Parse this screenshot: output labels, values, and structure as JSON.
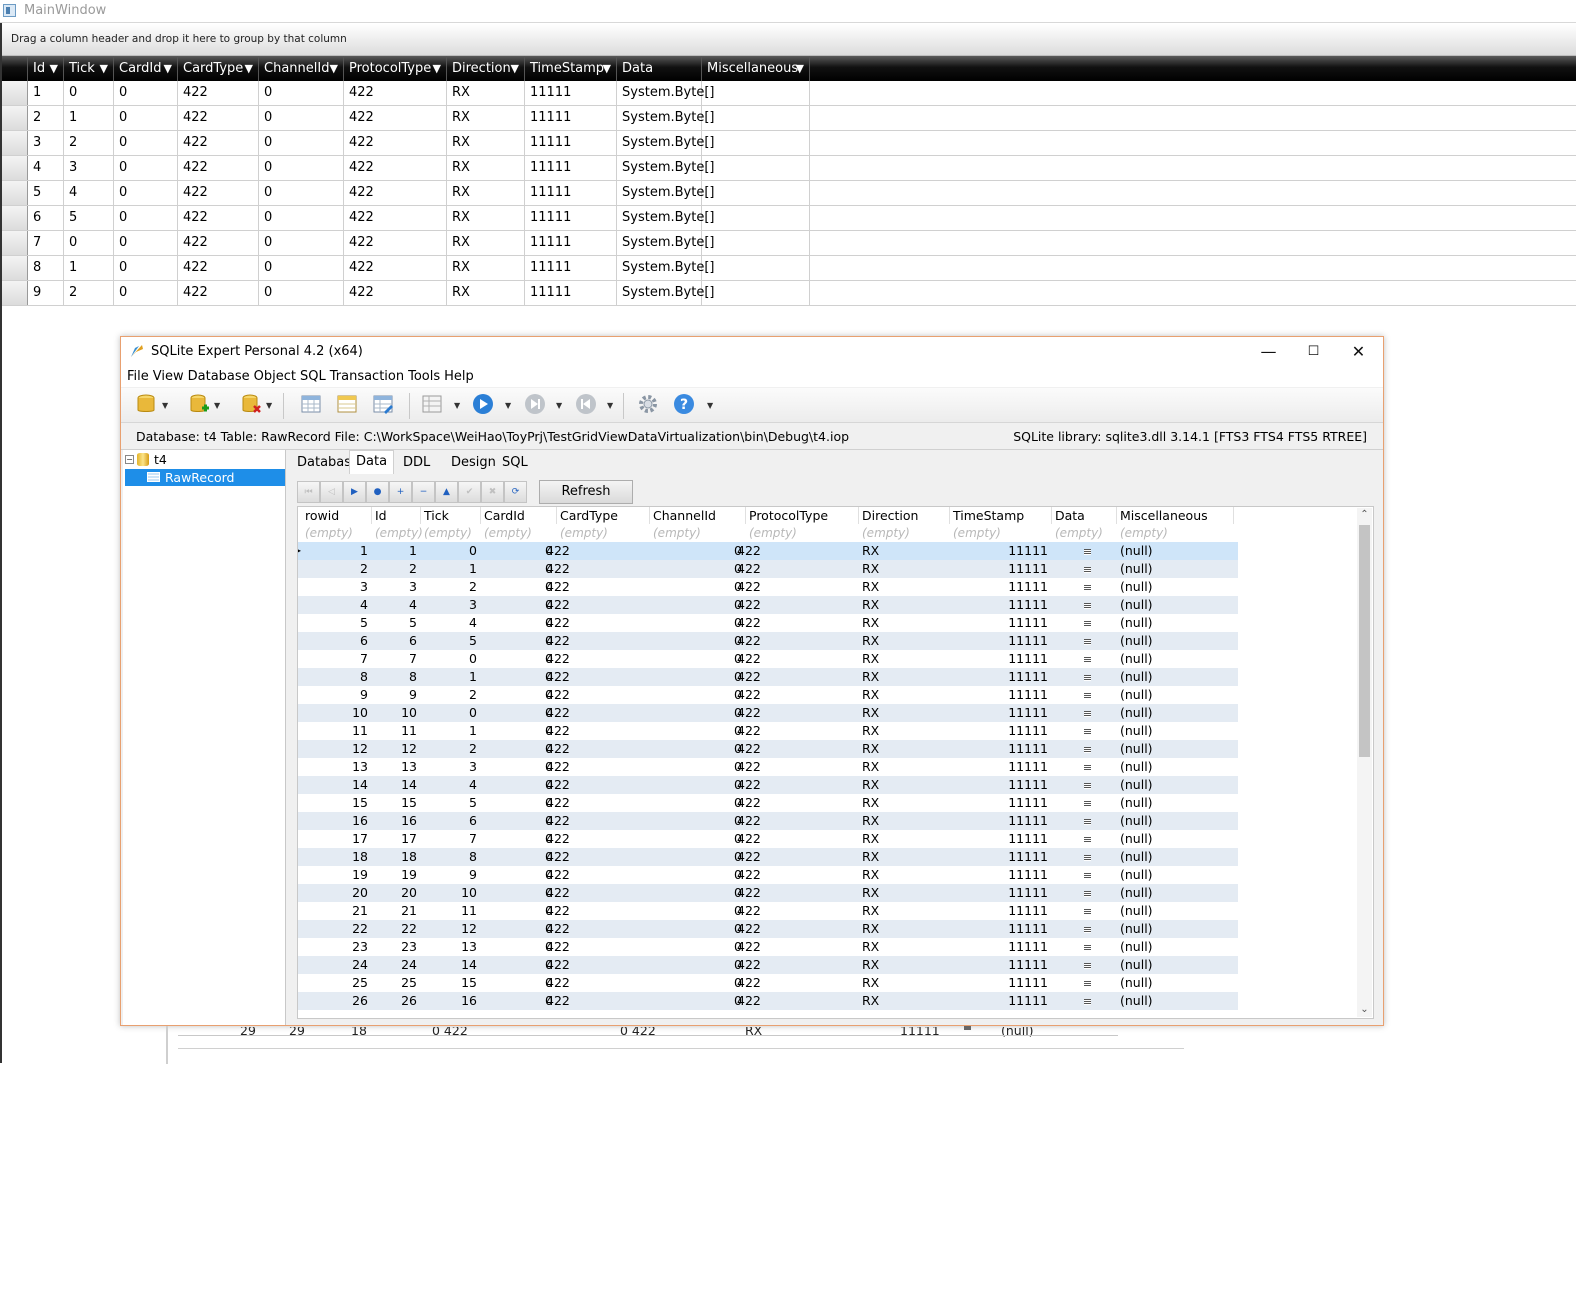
{
  "main_window": {
    "title": "MainWindow",
    "group_panel_hint": "Drag a column header and drop it here to group by that column",
    "columns": [
      "Id",
      "Tick",
      "CardId",
      "CardType",
      "ChannelId",
      "ProtocolType",
      "Direction",
      "TimeStamp",
      "Data",
      "Miscellaneous"
    ],
    "rows": [
      [
        "1",
        "0",
        "0",
        "422",
        "0",
        "422",
        "RX",
        "11111",
        "System.Byte[]",
        ""
      ],
      [
        "2",
        "1",
        "0",
        "422",
        "0",
        "422",
        "RX",
        "11111",
        "System.Byte[]",
        ""
      ],
      [
        "3",
        "2",
        "0",
        "422",
        "0",
        "422",
        "RX",
        "11111",
        "System.Byte[]",
        ""
      ],
      [
        "4",
        "3",
        "0",
        "422",
        "0",
        "422",
        "RX",
        "11111",
        "System.Byte[]",
        ""
      ],
      [
        "5",
        "4",
        "0",
        "422",
        "0",
        "422",
        "RX",
        "11111",
        "System.Byte[]",
        ""
      ],
      [
        "6",
        "5",
        "0",
        "422",
        "0",
        "422",
        "RX",
        "11111",
        "System.Byte[]",
        ""
      ],
      [
        "7",
        "0",
        "0",
        "422",
        "0",
        "422",
        "RX",
        "11111",
        "System.Byte[]",
        ""
      ],
      [
        "8",
        "1",
        "0",
        "422",
        "0",
        "422",
        "RX",
        "11111",
        "System.Byte[]",
        ""
      ],
      [
        "9",
        "2",
        "0",
        "422",
        "0",
        "422",
        "RX",
        "11111",
        "System.Byte[]",
        ""
      ]
    ]
  },
  "sqlite_expert": {
    "title": "SQLite Expert Personal 4.2 (x64)",
    "window_buttons": {
      "minimize": "—",
      "maximize": "☐",
      "close": "✕"
    },
    "menu": [
      "File",
      "View",
      "Database",
      "Object",
      "SQL",
      "Transaction",
      "Tools",
      "Help"
    ],
    "info_left": "Database: t4  Table: RawRecord  File: C:\\WorkSpace\\WeiHao\\ToyPrj\\TestGridViewDataVirtualization\\bin\\Debug\\t4.iop",
    "info_right": "SQLite library: sqlite3.dll 3.14.1 [FTS3 FTS4 FTS5 RTREE]",
    "tree": {
      "database": "t4",
      "table": "RawRecord",
      "expand_glyph": "−"
    },
    "tabs": [
      "Database",
      "Data",
      "DDL",
      "Design",
      "SQL"
    ],
    "active_tab": "Data",
    "refresh_label": "Refresh",
    "nav_icons": [
      "first-icon",
      "prior-page-icon",
      "prior-icon",
      "bookmark-icon",
      "insert-icon",
      "delete-icon",
      "edit-icon",
      "post-icon",
      "cancel-icon",
      "refresh-data-icon"
    ],
    "grid": {
      "columns": [
        "rowid",
        "Id",
        "Tick",
        "CardId",
        "CardType",
        "ChannelId",
        "ProtocolType",
        "Direction",
        "TimeStamp",
        "Data",
        "Miscellaneous"
      ],
      "filter_placeholder": "(empty)",
      "rows": [
        [
          "1",
          "1",
          "0",
          "0",
          "422",
          "0",
          "422",
          "RX",
          "11111",
          "(null)"
        ],
        [
          "2",
          "2",
          "1",
          "0",
          "422",
          "0",
          "422",
          "RX",
          "11111",
          "(null)"
        ],
        [
          "3",
          "3",
          "2",
          "0",
          "422",
          "0",
          "422",
          "RX",
          "11111",
          "(null)"
        ],
        [
          "4",
          "4",
          "3",
          "0",
          "422",
          "0",
          "422",
          "RX",
          "11111",
          "(null)"
        ],
        [
          "5",
          "5",
          "4",
          "0",
          "422",
          "0",
          "422",
          "RX",
          "11111",
          "(null)"
        ],
        [
          "6",
          "6",
          "5",
          "0",
          "422",
          "0",
          "422",
          "RX",
          "11111",
          "(null)"
        ],
        [
          "7",
          "7",
          "0",
          "0",
          "422",
          "0",
          "422",
          "RX",
          "11111",
          "(null)"
        ],
        [
          "8",
          "8",
          "1",
          "0",
          "422",
          "0",
          "422",
          "RX",
          "11111",
          "(null)"
        ],
        [
          "9",
          "9",
          "2",
          "0",
          "422",
          "0",
          "422",
          "RX",
          "11111",
          "(null)"
        ],
        [
          "10",
          "10",
          "0",
          "0",
          "422",
          "0",
          "422",
          "RX",
          "11111",
          "(null)"
        ],
        [
          "11",
          "11",
          "1",
          "0",
          "422",
          "0",
          "422",
          "RX",
          "11111",
          "(null)"
        ],
        [
          "12",
          "12",
          "2",
          "0",
          "422",
          "0",
          "422",
          "RX",
          "11111",
          "(null)"
        ],
        [
          "13",
          "13",
          "3",
          "0",
          "422",
          "0",
          "422",
          "RX",
          "11111",
          "(null)"
        ],
        [
          "14",
          "14",
          "4",
          "0",
          "422",
          "0",
          "422",
          "RX",
          "11111",
          "(null)"
        ],
        [
          "15",
          "15",
          "5",
          "0",
          "422",
          "0",
          "422",
          "RX",
          "11111",
          "(null)"
        ],
        [
          "16",
          "16",
          "6",
          "0",
          "422",
          "0",
          "422",
          "RX",
          "11111",
          "(null)"
        ],
        [
          "17",
          "17",
          "7",
          "0",
          "422",
          "0",
          "422",
          "RX",
          "11111",
          "(null)"
        ],
        [
          "18",
          "18",
          "8",
          "0",
          "422",
          "0",
          "422",
          "RX",
          "11111",
          "(null)"
        ],
        [
          "19",
          "19",
          "9",
          "0",
          "422",
          "0",
          "422",
          "RX",
          "11111",
          "(null)"
        ],
        [
          "20",
          "20",
          "10",
          "0",
          "422",
          "0",
          "422",
          "RX",
          "11111",
          "(null)"
        ],
        [
          "21",
          "21",
          "11",
          "0",
          "422",
          "0",
          "422",
          "RX",
          "11111",
          "(null)"
        ],
        [
          "22",
          "22",
          "12",
          "0",
          "422",
          "0",
          "422",
          "RX",
          "11111",
          "(null)"
        ],
        [
          "23",
          "23",
          "13",
          "0",
          "422",
          "0",
          "422",
          "RX",
          "11111",
          "(null)"
        ],
        [
          "24",
          "24",
          "14",
          "0",
          "422",
          "0",
          "422",
          "RX",
          "11111",
          "(null)"
        ],
        [
          "25",
          "25",
          "15",
          "0",
          "422",
          "0",
          "422",
          "RX",
          "11111",
          "(null)"
        ],
        [
          "26",
          "26",
          "16",
          "0",
          "422",
          "0",
          "422",
          "RX",
          "11111",
          "(null)"
        ]
      ]
    },
    "scroll": {
      "up": "⌃",
      "down": "⌄"
    }
  },
  "ghost_row": [
    "29",
    "29",
    "18",
    "0 422",
    "0 422",
    "RX",
    "11111",
    "(null)"
  ],
  "colors": {
    "accent_selection": "#1e8ee8",
    "row_alt": "#e4ebf3",
    "window_border": "#e8a070",
    "header_dark": "#000000"
  }
}
